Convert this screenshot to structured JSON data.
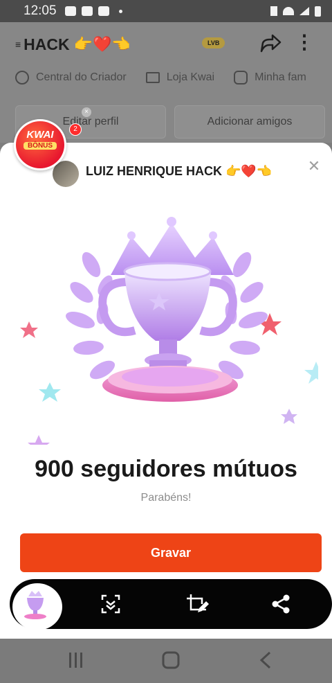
{
  "status_bar": {
    "time": "12:05"
  },
  "background": {
    "title": "HACK",
    "title_emoji": "👉❤️👈",
    "level_badge": "LVB",
    "links": [
      "Central do Criador",
      "Loja Kwai",
      "Minha fam"
    ],
    "buttons": {
      "edit_profile": "Editar perfil",
      "add_friends": "Adicionar amigos"
    }
  },
  "bonus_badge": {
    "title": "KWAI",
    "subtitle": "BÔNUS",
    "count": "2"
  },
  "modal": {
    "user_name": "LUIZ HENRIQUE HACK 👉❤️👈",
    "headline": "900 seguidores mútuos",
    "subtitle": "Parabéns!",
    "button_label": "Gravar"
  },
  "screenshot_toolbar": {
    "icons": [
      "scroll-capture-icon",
      "crop-edit-icon",
      "share-icon"
    ]
  },
  "colors": {
    "accent": "#ee4416",
    "toolbar": "#050505",
    "modal_bg": "#ffffff"
  }
}
